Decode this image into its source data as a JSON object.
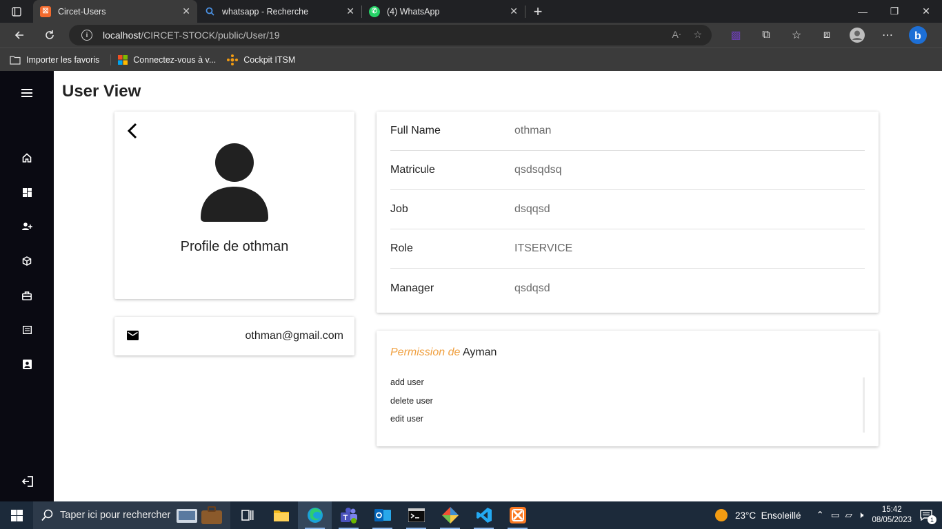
{
  "browser": {
    "tabs": [
      {
        "title": "Circet-Users",
        "active": true
      },
      {
        "title": "whatsapp - Recherche",
        "active": false
      },
      {
        "title": "(4) WhatsApp",
        "active": false
      }
    ],
    "url_host": "localhost",
    "url_path": "/CIRCET-STOCK/public/User/19",
    "favorites": [
      "Importer les favoris",
      "Connectez-vous à v...",
      "Cockpit ITSM"
    ]
  },
  "page": {
    "title": "User View"
  },
  "profile": {
    "heading": "Profile de othman",
    "email": "othman@gmail.com"
  },
  "details": [
    {
      "label": "Full Name",
      "value": "othman"
    },
    {
      "label": "Matricule",
      "value": "qsdsqdsq"
    },
    {
      "label": "Job",
      "value": "dsqqsd"
    },
    {
      "label": "Role",
      "value": "ITSERVICE"
    },
    {
      "label": "Manager",
      "value": "qsdqsd"
    }
  ],
  "permissions": {
    "title_prefix": "Permission de",
    "title_name": "Ayman",
    "items": [
      "add user",
      "delete user",
      "edit user"
    ]
  },
  "taskbar": {
    "search_placeholder": "Taper ici pour rechercher",
    "weather": "23°C  Ensoleillé",
    "time": "15:42",
    "date": "08/05/2023",
    "notification_count": "1"
  },
  "colors": {
    "sidebar": "#0a0a12",
    "accent": "#f0a040",
    "value_text": "#6b6b6b"
  }
}
